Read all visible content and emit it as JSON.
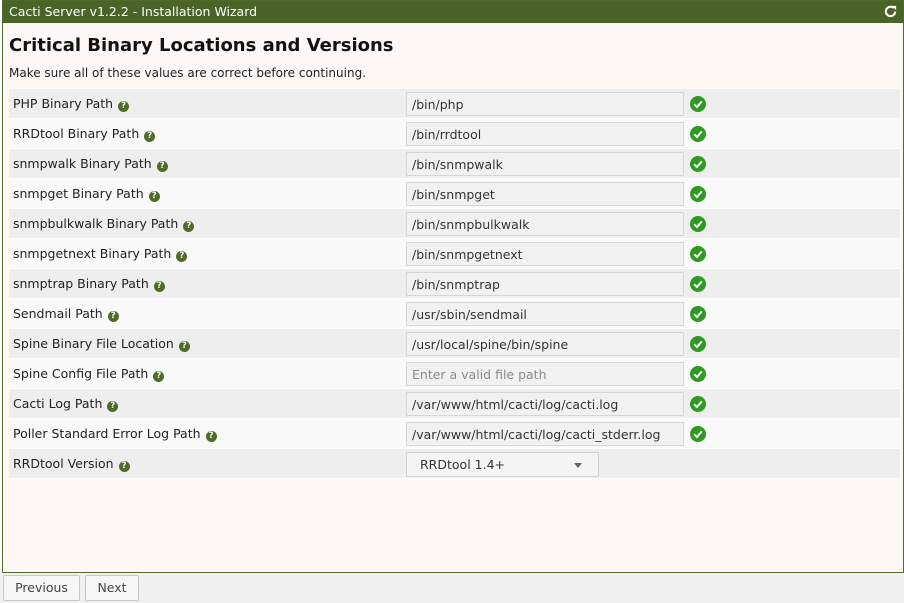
{
  "window": {
    "title": "Cacti Server v1.2.2 - Installation Wizard"
  },
  "main": {
    "heading": "Critical Binary Locations and Versions",
    "subheading": "Make sure all of these values are correct before continuing."
  },
  "rows": [
    {
      "label": "PHP Binary Path",
      "value": "/bin/php",
      "placeholder": "",
      "valid": true
    },
    {
      "label": "RRDtool Binary Path",
      "value": "/bin/rrdtool",
      "placeholder": "",
      "valid": true
    },
    {
      "label": "snmpwalk Binary Path",
      "value": "/bin/snmpwalk",
      "placeholder": "",
      "valid": true
    },
    {
      "label": "snmpget Binary Path",
      "value": "/bin/snmpget",
      "placeholder": "",
      "valid": true
    },
    {
      "label": "snmpbulkwalk Binary Path",
      "value": "/bin/snmpbulkwalk",
      "placeholder": "",
      "valid": true
    },
    {
      "label": "snmpgetnext Binary Path",
      "value": "/bin/snmpgetnext",
      "placeholder": "",
      "valid": true
    },
    {
      "label": "snmptrap Binary Path",
      "value": "/bin/snmptrap",
      "placeholder": "",
      "valid": true
    },
    {
      "label": "Sendmail Path",
      "value": "/usr/sbin/sendmail",
      "placeholder": "",
      "valid": true
    },
    {
      "label": "Spine Binary File Location",
      "value": "/usr/local/spine/bin/spine",
      "placeholder": "",
      "valid": true
    },
    {
      "label": "Spine Config File Path",
      "value": "",
      "placeholder": "Enter a valid file path",
      "valid": true
    },
    {
      "label": "Cacti Log Path",
      "value": "/var/www/html/cacti/log/cacti.log",
      "placeholder": "",
      "valid": true
    },
    {
      "label": "Poller Standard Error Log Path",
      "value": "/var/www/html/cacti/log/cacti_stderr.log",
      "placeholder": "",
      "valid": true
    }
  ],
  "rrdtool_version": {
    "label": "RRDtool Version",
    "selected": "RRDtool 1.4+"
  },
  "help_icon": {
    "glyph": "?"
  },
  "footer": {
    "previous_label": "Previous",
    "next_label": "Next"
  },
  "colors": {
    "accent": "#4a6427",
    "valid": "#2e9a22"
  }
}
